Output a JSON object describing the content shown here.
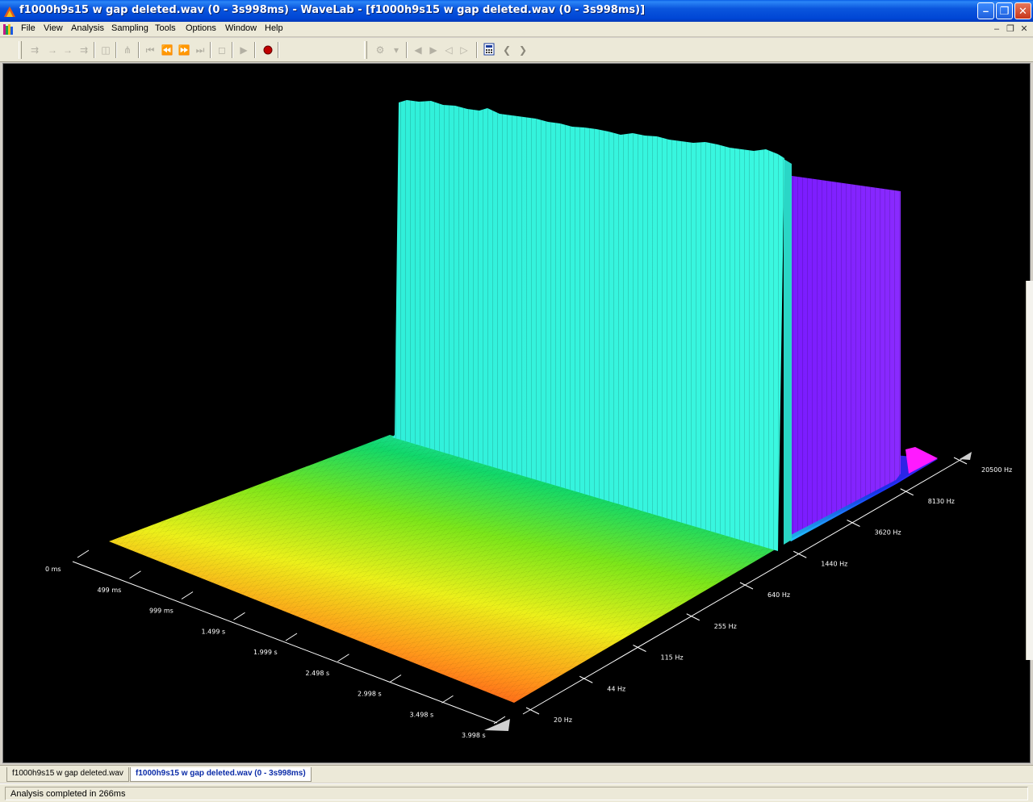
{
  "window": {
    "title": "f1000h9s15 w gap deleted.wav (0 - 3s998ms) - WaveLab - [f1000h9s15 w gap deleted.wav (0 - 3s998ms)]",
    "minimize_icon": "minimize-icon",
    "restore_icon": "restore-icon",
    "close_icon": "close-icon"
  },
  "menu": {
    "items": [
      "File",
      "View",
      "Analysis",
      "Sampling",
      "Tools",
      "Options",
      "Window",
      "Help"
    ]
  },
  "toolbar": {
    "icons": [
      "zoom-in-icon",
      "marker-icon",
      "play-loop-icon",
      "jump-icon",
      "snapshot-icon",
      "trim-icon",
      "go-start-icon",
      "rewind-icon",
      "forward-icon",
      "go-end-icon",
      "stop-icon",
      "play-icon",
      "record-icon",
      "analysis-mode-icon",
      "marker-prev-icon",
      "marker-next-icon",
      "region-prev-icon",
      "region-next-icon",
      "calculator-icon",
      "back-icon",
      "next-icon"
    ],
    "record_color": "#c00000"
  },
  "chart_data": {
    "type": "3d-spectrum-waterfall",
    "time_axis": {
      "ticks": [
        "0 ms",
        "499 ms",
        "999 ms",
        "1.499 s",
        "1.999 s",
        "2.498 s",
        "2.998 s",
        "3.498 s",
        "3.998 s"
      ]
    },
    "frequency_axis": {
      "ticks": [
        "20 Hz",
        "44 Hz",
        "115 Hz",
        "255 Hz",
        "640 Hz",
        "1440 Hz",
        "3620 Hz",
        "8130 Hz",
        "20500 Hz"
      ]
    },
    "series": [
      {
        "frequency_hz": 1000,
        "level": "high",
        "color": "#33f5dc"
      },
      {
        "frequency_hz": 9000,
        "level": "medium",
        "color": "#7a1fff"
      }
    ],
    "colors": {
      "floor_near": "#ff1a1a",
      "floor_mid": "#e8f21a",
      "floor_far": "#12d86a",
      "background": "#000000"
    }
  },
  "tabs": [
    {
      "label": "f1000h9s15 w gap deleted.wav",
      "active": false
    },
    {
      "label": "f1000h9s15 w gap deleted.wav (0 - 3s998ms)",
      "active": true
    }
  ],
  "status": {
    "text": "Analysis completed in 266ms"
  }
}
